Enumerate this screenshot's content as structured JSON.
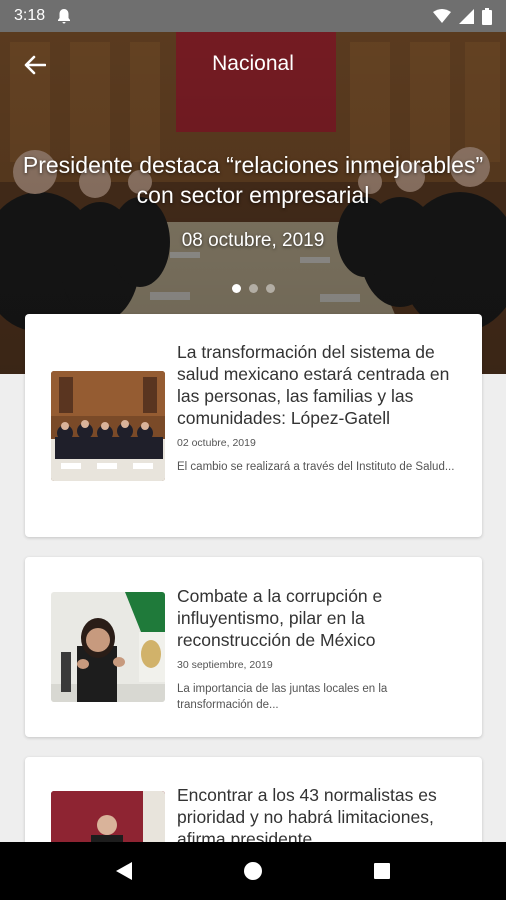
{
  "status_bar": {
    "time": "3:18",
    "icons": [
      "notification-bell-icon",
      "wifi-icon",
      "signal-icon",
      "battery-icon"
    ]
  },
  "header": {
    "title": "Nacional",
    "back_icon": "arrow-left-icon"
  },
  "hero": {
    "title": "Presidente destaca “relaciones inmejorables” con sector empresarial",
    "date": "08 octubre, 2019",
    "dots": {
      "count": 3,
      "active_index": 0
    }
  },
  "articles": [
    {
      "title": "La transformación del sistema de salud mexicano estará centrada en las personas, las familias y las comunidades: López-Gatell",
      "date": "02 octubre, 2019",
      "summary": "El cambio se realizará a través del Instituto de Salud..."
    },
    {
      "title": "Combate a la corrupción e influyentismo, pilar en la reconstrucción de México",
      "date": "30 septiembre, 2019",
      "summary": "La importancia de las juntas locales en la transformación de..."
    },
    {
      "title": "Encontrar a los 43 normalistas es prioridad y no habrá limitaciones, afirma presidente",
      "date": "",
      "summary": ""
    }
  ],
  "nav": {
    "back_icon": "triangle-back-icon",
    "home_icon": "circle-home-icon",
    "recents_icon": "square-recents-icon"
  },
  "colors": {
    "status_bar": "#6f6f6f",
    "background": "#eeeeee",
    "card": "#ffffff",
    "nav_bar": "#000000",
    "accent_red": "#9e1b2a"
  }
}
